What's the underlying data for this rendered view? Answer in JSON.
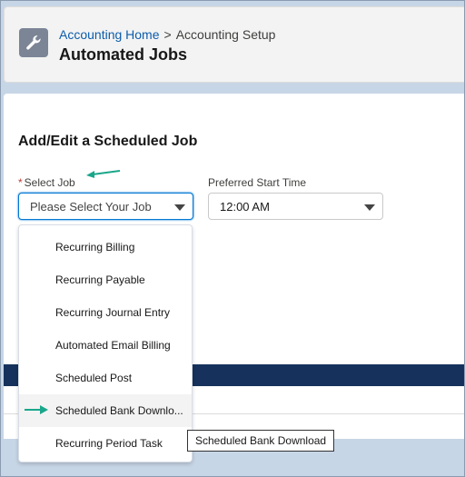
{
  "header": {
    "icon": "wrench-icon",
    "breadcrumb": {
      "home": "Accounting Home",
      "separator": ">",
      "current": "Accounting Setup"
    },
    "title": "Automated Jobs"
  },
  "form": {
    "section_title": "Add/Edit a Scheduled Job",
    "select_job": {
      "required_marker": "*",
      "label": "Select Job",
      "placeholder": "Please Select Your Job"
    },
    "start_time": {
      "label": "Preferred Start Time",
      "value": "12:00 AM"
    }
  },
  "dropdown": {
    "options": [
      "Recurring Billing",
      "Recurring Payable",
      "Recurring Journal Entry",
      "Automated Email Billing",
      "Scheduled Post",
      "Scheduled Bank Downlo...",
      "Recurring Period Task"
    ],
    "hovered_index": 5
  },
  "tooltip": {
    "text": "Scheduled Bank Download"
  },
  "colors": {
    "accent": "#0176d3",
    "annotation_arrow": "#1aa68a",
    "band": "#16325c"
  }
}
